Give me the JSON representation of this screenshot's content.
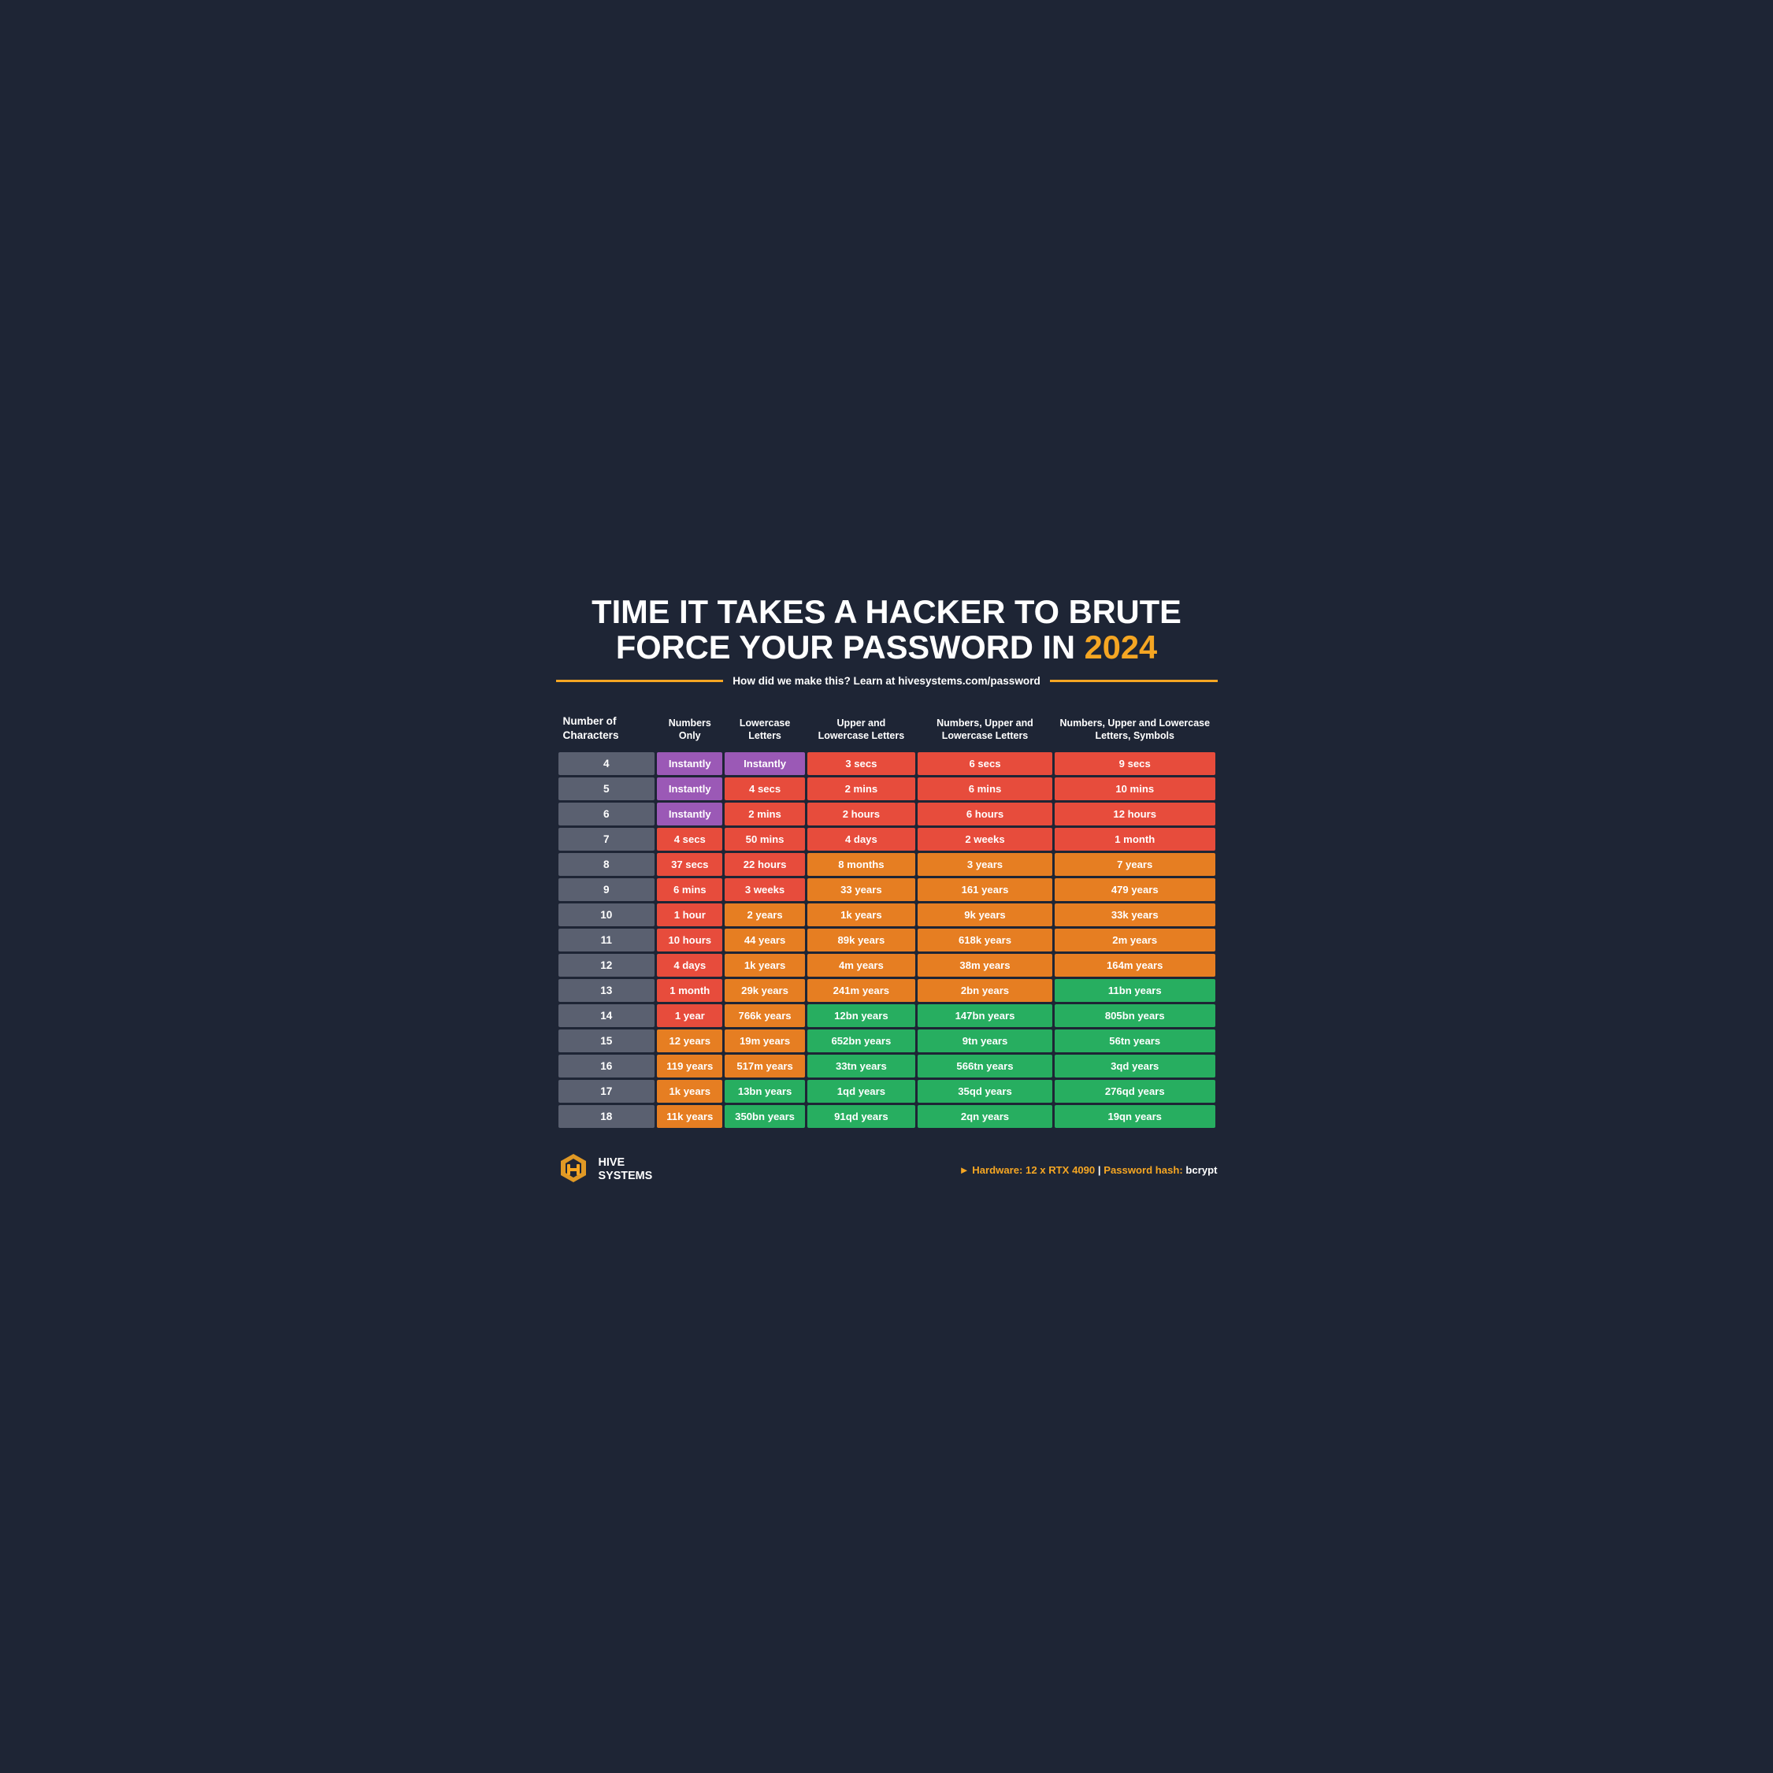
{
  "title": {
    "line1": "TIME IT TAKES A HACKER TO BRUTE",
    "line2": "FORCE YOUR PASSWORD IN",
    "year": "2024"
  },
  "subtitle": "How did we make this? Learn at hivesystems.com/password",
  "columns": [
    "Number of Characters",
    "Numbers Only",
    "Lowercase Letters",
    "Upper and Lowercase Letters",
    "Numbers, Upper and Lowercase Letters",
    "Numbers, Upper and Lowercase Letters, Symbols"
  ],
  "rows": [
    {
      "num": "4",
      "c1": "Instantly",
      "c1_color": "purple",
      "c2": "Instantly",
      "c2_color": "purple",
      "c3": "3 secs",
      "c3_color": "red",
      "c4": "6 secs",
      "c4_color": "red",
      "c5": "9 secs",
      "c5_color": "red"
    },
    {
      "num": "5",
      "c1": "Instantly",
      "c1_color": "purple",
      "c2": "4 secs",
      "c2_color": "red",
      "c3": "2 mins",
      "c3_color": "red",
      "c4": "6 mins",
      "c4_color": "red",
      "c5": "10 mins",
      "c5_color": "red"
    },
    {
      "num": "6",
      "c1": "Instantly",
      "c1_color": "purple",
      "c2": "2 mins",
      "c2_color": "red",
      "c3": "2 hours",
      "c3_color": "red",
      "c4": "6 hours",
      "c4_color": "red",
      "c5": "12 hours",
      "c5_color": "red"
    },
    {
      "num": "7",
      "c1": "4 secs",
      "c1_color": "red",
      "c2": "50 mins",
      "c2_color": "red",
      "c3": "4 days",
      "c3_color": "red",
      "c4": "2 weeks",
      "c4_color": "red",
      "c5": "1 month",
      "c5_color": "red"
    },
    {
      "num": "8",
      "c1": "37 secs",
      "c1_color": "red",
      "c2": "22 hours",
      "c2_color": "red",
      "c3": "8 months",
      "c3_color": "orange",
      "c4": "3 years",
      "c4_color": "orange",
      "c5": "7 years",
      "c5_color": "orange"
    },
    {
      "num": "9",
      "c1": "6 mins",
      "c1_color": "red",
      "c2": "3 weeks",
      "c2_color": "red",
      "c3": "33 years",
      "c3_color": "orange",
      "c4": "161 years",
      "c4_color": "orange",
      "c5": "479 years",
      "c5_color": "orange"
    },
    {
      "num": "10",
      "c1": "1 hour",
      "c1_color": "red",
      "c2": "2 years",
      "c2_color": "orange",
      "c3": "1k years",
      "c3_color": "orange",
      "c4": "9k years",
      "c4_color": "orange",
      "c5": "33k years",
      "c5_color": "orange"
    },
    {
      "num": "11",
      "c1": "10 hours",
      "c1_color": "red",
      "c2": "44 years",
      "c2_color": "orange",
      "c3": "89k years",
      "c3_color": "orange",
      "c4": "618k years",
      "c4_color": "orange",
      "c5": "2m years",
      "c5_color": "orange"
    },
    {
      "num": "12",
      "c1": "4 days",
      "c1_color": "red",
      "c2": "1k years",
      "c2_color": "orange",
      "c3": "4m years",
      "c3_color": "orange",
      "c4": "38m years",
      "c4_color": "orange",
      "c5": "164m years",
      "c5_color": "orange"
    },
    {
      "num": "13",
      "c1": "1 month",
      "c1_color": "red",
      "c2": "29k years",
      "c2_color": "orange",
      "c3": "241m years",
      "c3_color": "orange",
      "c4": "2bn years",
      "c4_color": "orange",
      "c5": "11bn years",
      "c5_color": "green"
    },
    {
      "num": "14",
      "c1": "1 year",
      "c1_color": "red",
      "c2": "766k years",
      "c2_color": "orange",
      "c3": "12bn years",
      "c3_color": "green",
      "c4": "147bn years",
      "c4_color": "green",
      "c5": "805bn years",
      "c5_color": "green"
    },
    {
      "num": "15",
      "c1": "12 years",
      "c1_color": "orange",
      "c2": "19m years",
      "c2_color": "orange",
      "c3": "652bn years",
      "c3_color": "green",
      "c4": "9tn years",
      "c4_color": "green",
      "c5": "56tn years",
      "c5_color": "green"
    },
    {
      "num": "16",
      "c1": "119 years",
      "c1_color": "orange",
      "c2": "517m years",
      "c2_color": "orange",
      "c3": "33tn years",
      "c3_color": "green",
      "c4": "566tn years",
      "c4_color": "green",
      "c5": "3qd years",
      "c5_color": "green"
    },
    {
      "num": "17",
      "c1": "1k years",
      "c1_color": "orange",
      "c2": "13bn years",
      "c2_color": "green",
      "c3": "1qd years",
      "c3_color": "green",
      "c4": "35qd years",
      "c4_color": "green",
      "c5": "276qd years",
      "c5_color": "green"
    },
    {
      "num": "18",
      "c1": "11k years",
      "c1_color": "orange",
      "c2": "350bn years",
      "c2_color": "green",
      "c3": "91qd years",
      "c3_color": "green",
      "c4": "2qn years",
      "c4_color": "green",
      "c5": "19qn years",
      "c5_color": "green"
    }
  ],
  "footer": {
    "logo_name": "HIVE\nSYSTEMS",
    "hardware_label": "Hardware:",
    "hardware_value": "12 x RTX 4090",
    "separator": "|",
    "hash_label": "Password hash:",
    "hash_value": "bcrypt"
  }
}
